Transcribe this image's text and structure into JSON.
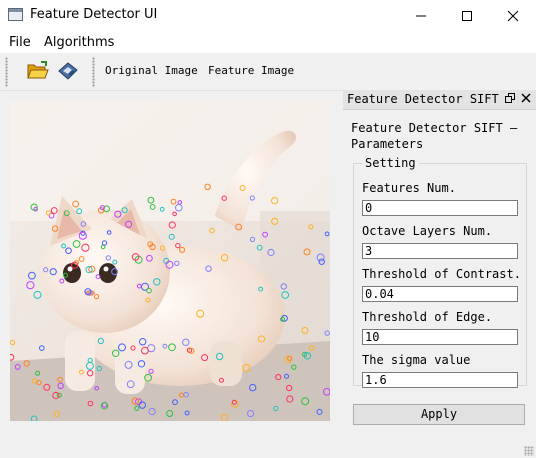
{
  "window": {
    "title": "Feature Detector UI",
    "controls": {
      "minimize": "minimize-icon",
      "maximize": "maximize-icon",
      "close": "close-icon"
    }
  },
  "menu": {
    "items": [
      {
        "label": "File"
      },
      {
        "label": "Algorithms"
      }
    ]
  },
  "toolbar": {
    "open_icon": "folder-open-icon",
    "save_icon": "save-disk-icon",
    "original_label": "Original Image",
    "feature_label": "Feature Image"
  },
  "image": {
    "subject": "kitten photo with detected keypoint circles"
  },
  "dock": {
    "title": "Feature Detector SIFT",
    "float_icon": "float-icon",
    "close_icon": "close-icon",
    "panel_title": "Feature Detector SIFT — Parameters",
    "group_title": "Setting",
    "fields": [
      {
        "label": "Features Num.",
        "value": "0"
      },
      {
        "label": "Octave Layers Num.",
        "value": "3"
      },
      {
        "label": "Threshold of Contrast.",
        "value": "0.04"
      },
      {
        "label": "Threshold of Edge.",
        "value": "10"
      },
      {
        "label": "The sigma value",
        "value": "1.6"
      }
    ],
    "apply_label": "Apply"
  },
  "colors": {
    "keypoints": [
      "#ff3060",
      "#30c040",
      "#4060ff",
      "#ffb020",
      "#c040ff",
      "#20c0c0",
      "#ff8020",
      "#8080ff"
    ]
  }
}
